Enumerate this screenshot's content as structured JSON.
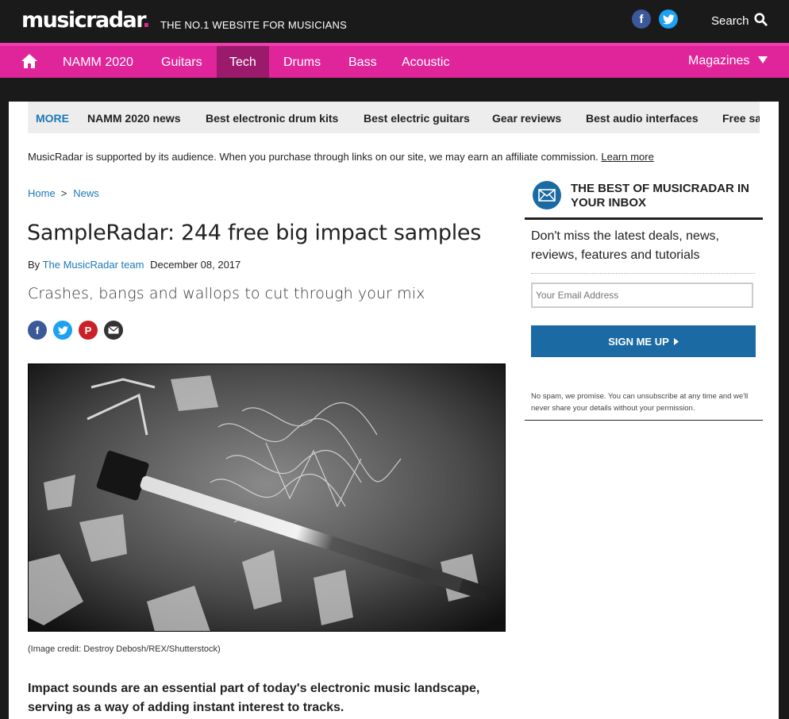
{
  "header": {
    "logo": "musicradar",
    "logo_dot": ".",
    "tagline": "THE NO.1 WEBSITE FOR MUSICIANS",
    "facebook_glyph": "f",
    "search_label": "Search"
  },
  "nav": {
    "items": [
      {
        "label": "NAMM 2020",
        "active": false
      },
      {
        "label": "Guitars",
        "active": false
      },
      {
        "label": "Tech",
        "active": true
      },
      {
        "label": "Drums",
        "active": false
      },
      {
        "label": "Bass",
        "active": false
      },
      {
        "label": "Acoustic",
        "active": false
      }
    ],
    "magazines_label": "Magazines"
  },
  "morebar": {
    "more_label": "MORE",
    "links": [
      "NAMM 2020 news",
      "Best electronic drum kits",
      "Best electric guitars",
      "Gear reviews",
      "Best audio interfaces",
      "Free sa"
    ]
  },
  "affiliate": {
    "text": "MusicRadar is supported by its audience. When you purchase through links on our site, we may earn an affiliate commission.",
    "link": "Learn more"
  },
  "breadcrumb": {
    "home": "Home",
    "separator": ">",
    "section": "News"
  },
  "article": {
    "title": "SampleRadar: 244 free big impact samples",
    "by_label": "By",
    "author": "The MusicRadar team",
    "date": "December 08, 2017",
    "strapline": "Crashes, bangs and wallops to cut through your mix",
    "image_credit": "(Image credit: Destroy Debosh/REX/Shutterstock)",
    "lead": "Impact sounds are an essential part of today's electronic music landscape, serving as a way of adding instant interest to tracks."
  },
  "share": {
    "facebook": "f",
    "pinterest": "P"
  },
  "newsletter": {
    "title": "THE BEST OF MUSICRADAR IN YOUR INBOX",
    "description": "Don't miss the latest deals, news, reviews, features and tutorials",
    "email_placeholder": "Your Email Address",
    "button_label": "SIGN ME UP",
    "disclaimer": "No spam, we promise. You can unsubscribe at any time and we'll never share your details without your permission."
  },
  "colors": {
    "brand_pink": "#e0259a",
    "active_tab": "#9b1a6c",
    "link_blue": "#1b79b5",
    "button_blue": "#1b6aa3"
  },
  "icons": [
    "home-icon",
    "search-icon",
    "facebook-icon",
    "twitter-icon",
    "pinterest-icon",
    "email-icon",
    "envelope-icon",
    "caret-down-icon",
    "caret-right-icon"
  ]
}
